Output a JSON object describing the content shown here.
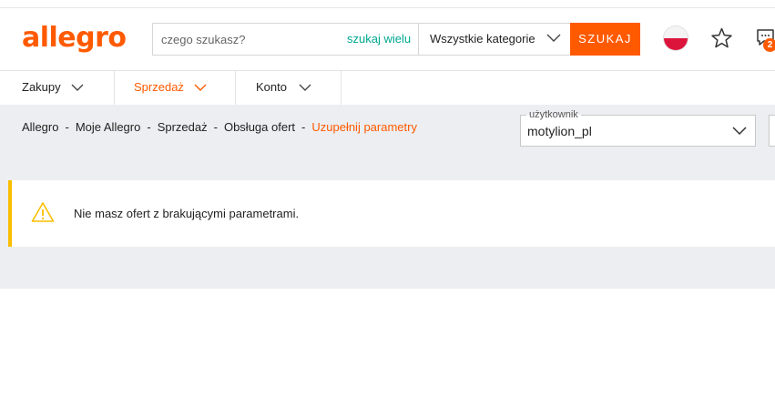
{
  "header": {
    "logo": "allegro",
    "search": {
      "placeholder": "czego szukasz?",
      "search_many": "szukaj wielu",
      "category": "Wszystkie kategorie",
      "button": "SZUKAJ"
    },
    "icons": [
      "flag-poland-icon",
      "star-icon",
      "chat-icon"
    ],
    "notification_count": "2"
  },
  "nav": {
    "items": [
      {
        "label": "Zakupy"
      },
      {
        "label": "Sprzedaż"
      },
      {
        "label": "Konto"
      }
    ]
  },
  "breadcrumb": {
    "items": [
      "Allegro",
      "Moje Allegro",
      "Sprzedaż",
      "Obsługa ofert",
      "Uzupełnij parametry"
    ],
    "separator": "-"
  },
  "user_select": {
    "label": "użytkownik",
    "value": "motylion_pl"
  },
  "alert": {
    "message": "Nie masz ofert z brakującymi parametrami."
  },
  "colors": {
    "brand": "#ff5a00",
    "search_many": "#00a790",
    "warning": "#fabd00",
    "content_bg": "#eceef1"
  }
}
